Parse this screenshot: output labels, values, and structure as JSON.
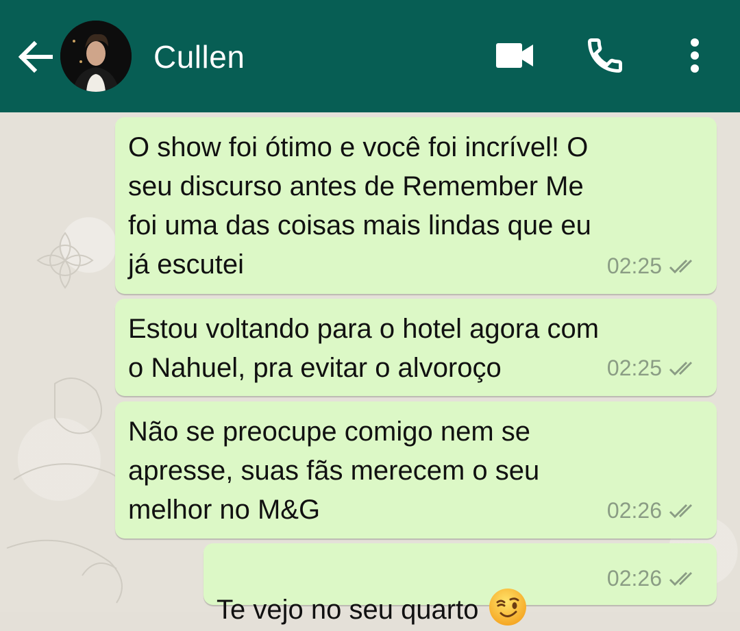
{
  "header": {
    "contact_name": "Cullen",
    "back_icon": "arrow-left-icon",
    "video_icon": "video-camera-icon",
    "call_icon": "phone-icon",
    "menu_icon": "more-vertical-icon",
    "color": "#075e54"
  },
  "messages": [
    {
      "text": "O show foi ótimo e você foi incrível! O\nseu discurso antes de Remember Me\nfoi uma das coisas mais lindas que eu\njá escutei",
      "time": "02:25",
      "status": "read-double-check"
    },
    {
      "text": "Estou voltando para o hotel agora com\no Nahuel, pra evitar o alvoroço",
      "time": "02:25",
      "status": "read-double-check"
    },
    {
      "text": "Não se preocupe comigo nem se\napresse, suas fãs merecem o seu\nmelhor no M&G",
      "time": "02:26",
      "status": "read-double-check"
    },
    {
      "text": "Te vejo no seu quarto",
      "emoji": "winking-face-emoji",
      "time": "02:26",
      "status": "read-double-check"
    }
  ],
  "colors": {
    "outgoing_bubble": "#dcf8c6",
    "meta_text": "#8a9c84"
  }
}
